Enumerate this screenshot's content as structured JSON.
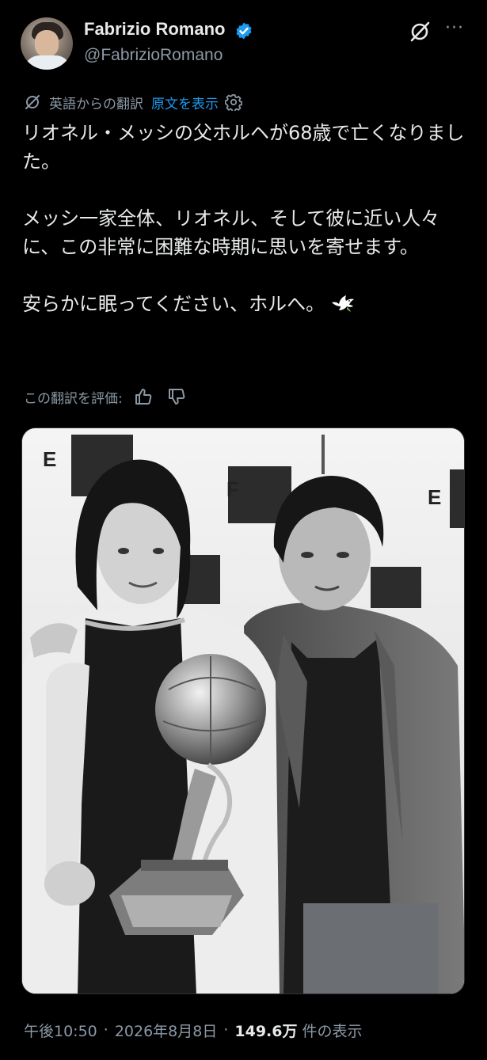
{
  "author": {
    "display_name": "Fabrizio Romano",
    "handle": "@FabrizioRomano"
  },
  "translation": {
    "label": "英語からの翻訳",
    "show_original": "原文を表示",
    "rate_label": "この翻訳を評価:"
  },
  "tweet": {
    "paragraphs": [
      "リオネル・メッシの父ホルヘが68歳で亡くなりました。",
      "メッシ一家全体、リオネル、そして彼に近い人々に、この非常に困難な時期に思いを寄せます。",
      "安らかに眠ってください、ホルへ。"
    ]
  },
  "media": {
    "backdrop_logo_text": [
      "E",
      "F",
      "E"
    ]
  },
  "meta": {
    "time": "午後10:50",
    "date": "2026年8月8日",
    "views_count": "149.6万",
    "views_label": "件の表示"
  },
  "icons": {
    "verified": "verified-badge-icon",
    "grok": "grok-icon",
    "more": "more-icon",
    "translate": "translate-icon",
    "settings": "gear-icon",
    "like_translation": "thumbs-up-icon",
    "dislike_translation": "thumbs-down-icon",
    "dove": "dove-emoji-icon"
  },
  "colors": {
    "background": "#000000",
    "text": "#e7e9ea",
    "muted": "#8b98a5",
    "link": "#1d9bf0"
  }
}
